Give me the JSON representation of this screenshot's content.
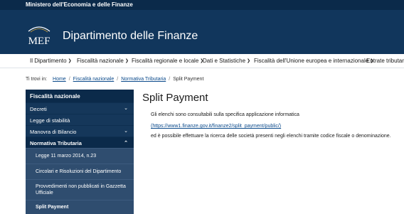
{
  "topbar": {
    "text": "Ministero dell'Economia e delle Finanze"
  },
  "header": {
    "logo_text": "MEF",
    "title": "Dipartimento delle Finanze"
  },
  "nav": {
    "items": [
      {
        "label": "Il Dipartimento"
      },
      {
        "label": "Fiscalità nazionale"
      },
      {
        "label": "Fiscalità regionale e locale"
      },
      {
        "label": "Dati e Statistiche"
      },
      {
        "label": "Fiscalità dell'Unione europea e internazionale"
      },
      {
        "label": "Entrate tributarie"
      }
    ]
  },
  "breadcrumb": {
    "prefix": "Ti trovi in:",
    "items": [
      "Home",
      "Fiscalità nazionale",
      "Normativa Tributaria"
    ],
    "current": "Split Payment"
  },
  "sidebar": {
    "title": "Fiscalità nazionale",
    "items": [
      {
        "label": "Decreti"
      },
      {
        "label": "Legge di stabilità"
      },
      {
        "label": "Manovra di Bilancio"
      },
      {
        "label": "Normativa Tributaria"
      }
    ],
    "subitems": [
      {
        "label": "Legge 11 marzo 2014, n.23"
      },
      {
        "label": "Circolari e Risoluzioni del Dipartimento"
      },
      {
        "label": "Provvedimenti non pubblicati in Gazzetta Ufficiale"
      },
      {
        "label": "Split Payment"
      }
    ]
  },
  "main": {
    "title": "Split Payment",
    "line1": "Gli elenchi sono consultabili sulla specifica applicazione informatica",
    "link": "(https://www1.finanze.gov.it/finanze2/split_payment/public/)",
    "line2": "ed è possibile effettuare la ricerca delle società presenti negli elenchi tramite codice fiscale o denominazione."
  },
  "colors": {
    "header": "#11365c",
    "topbar": "#0b2a4a",
    "sidebar": "#15375a",
    "link": "#0b4a8b"
  }
}
